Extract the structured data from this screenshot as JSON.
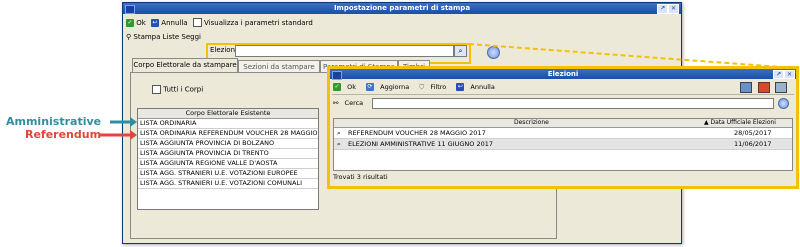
{
  "main_window": {
    "title": "Impostazione parametri di stampa",
    "toolbar": {
      "ok": "Ok",
      "cancel": "Annulla",
      "show_std": "Visualizza i parametri standard"
    },
    "section_label": "Stampa Liste Seggi",
    "elezioni_label": "Elezioni",
    "elezioni_value": "",
    "tabs": [
      "Corpo Elettorale da stampare",
      "Sezioni da stampare",
      "Parametri di Stampa",
      "Timbri"
    ],
    "tutti_label": "Tutti i Corpi",
    "list_header": "Corpo Elettorale Esistente",
    "list_items": [
      "LISTA ORDINARIA",
      "LISTA ORDINARIA REFERENDUM VOUCHER 28 MAGGIO 2017",
      "LISTA AGGIUNTA PROVINCIA DI BOLZANO",
      "LISTA AGGIUNTA PROVINCIA DI TRENTO",
      "LISTA AGGIUNTA REGIONE VALLE D'AOSTA",
      "LISTA AGG. STRANIERI U.E. VOTAZIONI EUROPEE",
      "LISTA AGG. STRANIERI U.E. VOTAZIONI COMUNALI"
    ]
  },
  "annotations": {
    "administrative": "Amministrative",
    "referendum": "Referendum"
  },
  "colors": {
    "admin_label": "#2f8fa0",
    "ref_label": "#e0463c",
    "highlight": "#f2c20a"
  },
  "popup": {
    "title": "Elezioni",
    "toolbar": {
      "ok": "Ok",
      "refresh": "Aggiorna",
      "filter": "Filtro",
      "cancel": "Annulla"
    },
    "search_label": "Cerca",
    "search_value": "",
    "columns": [
      "Descrizione",
      "Data Ufficiale Elezioni"
    ],
    "rows": [
      {
        "desc": "REFERENDUM VOUCHER 28 MAGGIO 2017",
        "date": "28/05/2017"
      },
      {
        "desc": "ELEZIONI AMMINISTRATIVE 11 GIUGNO 2017",
        "date": "11/06/2017"
      }
    ],
    "status": "Trovati 3 risultati"
  }
}
